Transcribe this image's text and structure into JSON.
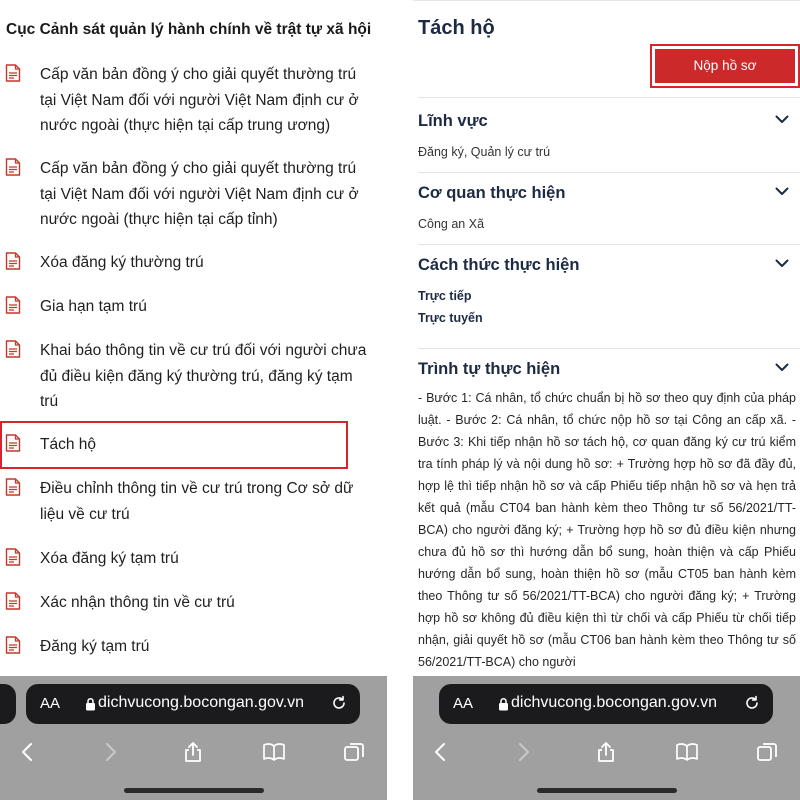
{
  "left": {
    "heading": "Cục Cảnh sát quản lý hành chính về trật tự xã hội",
    "items": [
      {
        "lines": [
          "Cấp văn bản đồng ý cho giải quyết thường trú",
          "tại Việt Nam đối với người Việt Nam định cư ở",
          "nước ngoài (thực hiện tại cấp trung ương)"
        ]
      },
      {
        "lines": [
          "Cấp văn bản đồng ý cho giải quyết thường trú",
          "tại Việt Nam đối với người Việt Nam định cư ở",
          "nước ngoài (thực hiện tại cấp tỉnh)"
        ]
      },
      {
        "lines": [
          "Xóa đăng ký thường trú"
        ]
      },
      {
        "lines": [
          "Gia hạn tạm trú"
        ]
      },
      {
        "lines": [
          "Khai báo thông tin về cư trú đối với người chưa",
          "đủ điều kiện đăng ký thường trú, đăng ký tạm",
          "trú"
        ]
      },
      {
        "lines": [
          "Tách hộ"
        ]
      },
      {
        "lines": [
          "Điều chỉnh thông tin về cư trú trong Cơ sở dữ",
          "liệu về cư trú"
        ]
      },
      {
        "lines": [
          "Xóa đăng ký tạm trú"
        ]
      },
      {
        "lines": [
          "Xác nhận thông tin về cư trú"
        ]
      },
      {
        "lines": [
          "Đăng ký tạm trú"
        ]
      }
    ]
  },
  "right": {
    "title": "Tách hộ",
    "submit_label": "Nộp hồ sơ",
    "sections": {
      "field": {
        "title": "Lĩnh vực",
        "value": "Đăng ký, Quản lý cư trú"
      },
      "agency": {
        "title": "Cơ quan thực hiện",
        "value": "Công an Xã"
      },
      "method": {
        "title": "Cách thức thực hiện",
        "values": [
          "Trực tiếp",
          "Trực tuyến"
        ]
      },
      "procedure": {
        "title": "Trình tự thực hiện",
        "text": "- Bước 1: Cá nhân, tổ chức chuẩn bị hồ sơ theo quy định của pháp luật. - Bước 2: Cá nhân, tổ chức nộp hồ sơ tại Công an cấp xã. - Bước 3: Khi tiếp nhận hồ sơ tách hộ, cơ quan đăng ký cư trú kiểm tra tính pháp lý và nội dung hồ sơ: + Trường hợp hồ sơ đã đầy đủ, hợp lệ thì tiếp nhận hồ sơ và cấp Phiếu tiếp nhận hồ sơ và hẹn trả kết quả (mẫu CT04 ban hành kèm theo Thông tư số 56/2021/TT-BCA) cho người đăng ký; + Trường hợp hồ sơ đủ điều kiện nhưng chưa đủ hồ sơ thì hướng dẫn bổ sung, hoàn thiện và cấp Phiếu hướng dẫn bổ sung, hoàn thiện hồ sơ (mẫu CT05 ban hành kèm theo Thông tư số 56/2021/TT-BCA) cho người đăng ký; + Trường hợp hồ sơ không đủ điều kiện thì từ chối và cấp Phiếu từ chối tiếp nhận, giải quyết hồ sơ (mẫu CT06 ban hành kèm theo Thông tư số 56/2021/TT-BCA) cho người"
      }
    }
  },
  "safari": {
    "aa_label": "AA",
    "url": "dichvucong.bocongan.gov.vn"
  },
  "colors": {
    "highlight": "#d9232d",
    "button": "#cc2a2a",
    "heading_navy": "#1c2a43",
    "doc_icon": "#c0392b"
  }
}
